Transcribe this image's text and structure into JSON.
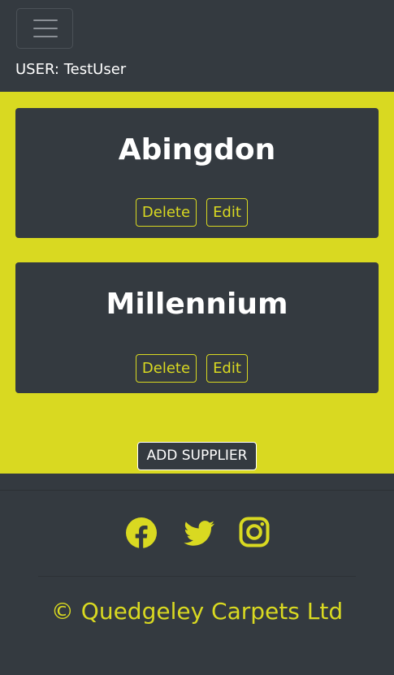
{
  "navbar": {
    "toggle_icon": "hamburger-icon",
    "user_label": "USER: TestUser"
  },
  "suppliers": [
    {
      "name": "Abingdon",
      "delete_label": "Delete",
      "edit_label": "Edit"
    },
    {
      "name": "Millennium",
      "delete_label": "Delete",
      "edit_label": "Edit"
    }
  ],
  "add_supplier_label": "ADD SUPPLIER",
  "footer": {
    "social_icons": [
      "facebook-icon",
      "twitter-icon",
      "instagram-icon"
    ],
    "copyright": "© Quedgeley Carpets Ltd"
  },
  "colors": {
    "accent": "#d9d921",
    "dark": "#343a40",
    "white": "#ffffff"
  }
}
